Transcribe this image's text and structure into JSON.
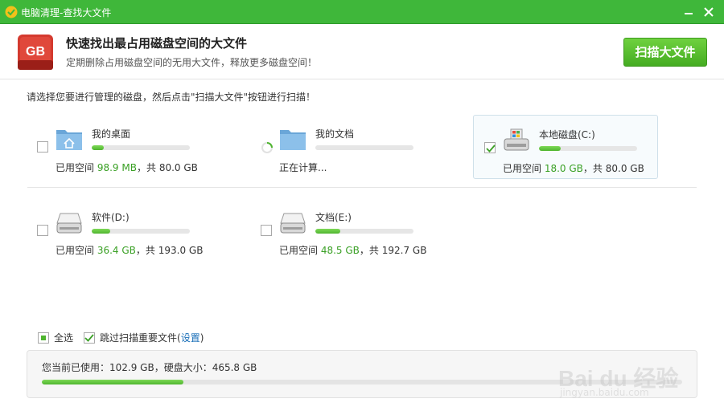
{
  "window": {
    "title": "电脑清理-查找大文件",
    "min_icon": "minimize-icon",
    "close_icon": "close-icon"
  },
  "header": {
    "icon_text": "GB",
    "title": "快速找出最占用磁盘空间的大文件",
    "subtitle": "定期删除占用磁盘空间的无用大文件，释放更多磁盘空间！",
    "scan_button": "扫描大文件"
  },
  "instruction": "请选择您要进行管理的磁盘，然后点击\"扫描大文件\"按钮进行扫描！",
  "drives": [
    {
      "name": "我的桌面",
      "icon": "desktop-folder-icon",
      "checked": false,
      "loading": false,
      "usage_prefix": "已用空间",
      "used": "98.9 MB",
      "usage_mid": "，共",
      "total": "80.0 GB",
      "fill": 0.12
    },
    {
      "name": "我的文档",
      "icon": "documents-folder-icon",
      "checked": false,
      "loading": true,
      "status": "正在计算...",
      "fill": 0
    },
    {
      "name": "本地磁盘(C:)",
      "icon": "system-drive-icon",
      "checked": true,
      "loading": false,
      "usage_prefix": "已用空间",
      "used": "18.0 GB",
      "usage_mid": "，共",
      "total": "80.0 GB",
      "fill": 0.22
    },
    {
      "name": "软件(D:)",
      "icon": "hard-drive-icon",
      "checked": false,
      "loading": false,
      "usage_prefix": "已用空间",
      "used": "36.4 GB",
      "usage_mid": "，共",
      "total": "193.0 GB",
      "fill": 0.19
    },
    {
      "name": "文档(E:)",
      "icon": "hard-drive-icon",
      "checked": false,
      "loading": false,
      "usage_prefix": "已用空间",
      "used": "48.5 GB",
      "usage_mid": "，共",
      "total": "192.7 GB",
      "fill": 0.25
    }
  ],
  "options": {
    "select_all": "全选",
    "skip_important_prefix": "跳过扫描重要文件(",
    "settings_link": "设置",
    "skip_important_suffix": ")"
  },
  "summary": {
    "text": "您当前已使用：102.9 GB，硬盘大小：465.8 GB",
    "fill": 0.221
  },
  "watermark": {
    "brand": "Bai du 经验",
    "url": "jingyan.baidu.com"
  },
  "colors": {
    "titlebar": "#3fb73a",
    "accent_green": "#3aa025",
    "link_blue": "#1a6fb8",
    "gb_red": "#d43a2f"
  }
}
